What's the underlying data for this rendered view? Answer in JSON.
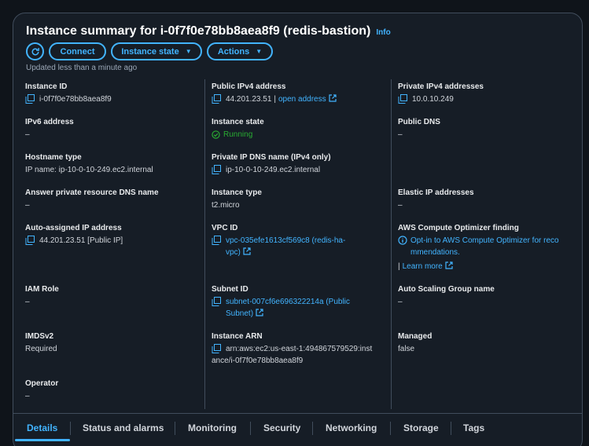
{
  "header": {
    "title": "Instance summary for i-0f7f0e78bb8aea8f9 (redis-bastion)",
    "info": "Info",
    "updated": "Updated less than a minute ago"
  },
  "buttons": {
    "connect": "Connect",
    "instance_state": "Instance state",
    "actions": "Actions"
  },
  "fields": {
    "instance_id": {
      "label": "Instance ID",
      "value": "i-0f7f0e78bb8aea8f9"
    },
    "public_ipv4": {
      "label": "Public IPv4 address",
      "value": "44.201.23.51",
      "sep": "|",
      "link": "open address"
    },
    "private_ipv4": {
      "label": "Private IPv4 addresses",
      "value": "10.0.10.249"
    },
    "ipv6": {
      "label": "IPv6 address",
      "value": "–"
    },
    "instance_state": {
      "label": "Instance state",
      "value": "Running"
    },
    "public_dns": {
      "label": "Public DNS",
      "value": "–"
    },
    "hostname_type": {
      "label": "Hostname type",
      "value": "IP name: ip-10-0-10-249.ec2.internal"
    },
    "private_ip_dns": {
      "label": "Private IP DNS name (IPv4 only)",
      "value": "ip-10-0-10-249.ec2.internal"
    },
    "answer_dns": {
      "label": "Answer private resource DNS name",
      "value": "–"
    },
    "instance_type": {
      "label": "Instance type",
      "value": "t2.micro"
    },
    "elastic_ip": {
      "label": "Elastic IP addresses",
      "value": "–"
    },
    "auto_ip": {
      "label": "Auto-assigned IP address",
      "value": "44.201.23.51 [Public IP]"
    },
    "vpc_id": {
      "label": "VPC ID",
      "line1": "vpc-035efe1613cf569c8 (redis-ha-",
      "line2": "vpc)"
    },
    "optimizer": {
      "label": "AWS Compute Optimizer finding",
      "line1": "Opt-in to AWS Compute Optimizer for reco",
      "line2": "mmendations.",
      "learn": "Learn more"
    },
    "iam_role": {
      "label": "IAM Role",
      "value": "–"
    },
    "subnet_id": {
      "label": "Subnet ID",
      "line1": "subnet-007cf6e696322214a (Public",
      "line2": "Subnet)"
    },
    "asg_name": {
      "label": "Auto Scaling Group name",
      "value": "–"
    },
    "imdsv2": {
      "label": "IMDSv2",
      "value": "Required"
    },
    "instance_arn": {
      "label": "Instance ARN",
      "line1": "arn:aws:ec2:us-east-1:494867579529:inst",
      "line2": "ance/i-0f7f0e78bb8aea8f9"
    },
    "managed": {
      "label": "Managed",
      "value": "false"
    },
    "operator": {
      "label": "Operator",
      "value": "–"
    }
  },
  "tabs": [
    "Details",
    "Status and alarms",
    "Monitoring",
    "Security",
    "Networking",
    "Storage",
    "Tags"
  ],
  "colors": {
    "accent": "#42b4ff",
    "success": "#29ad32",
    "background": "#0f141a",
    "panel": "#161d26"
  }
}
